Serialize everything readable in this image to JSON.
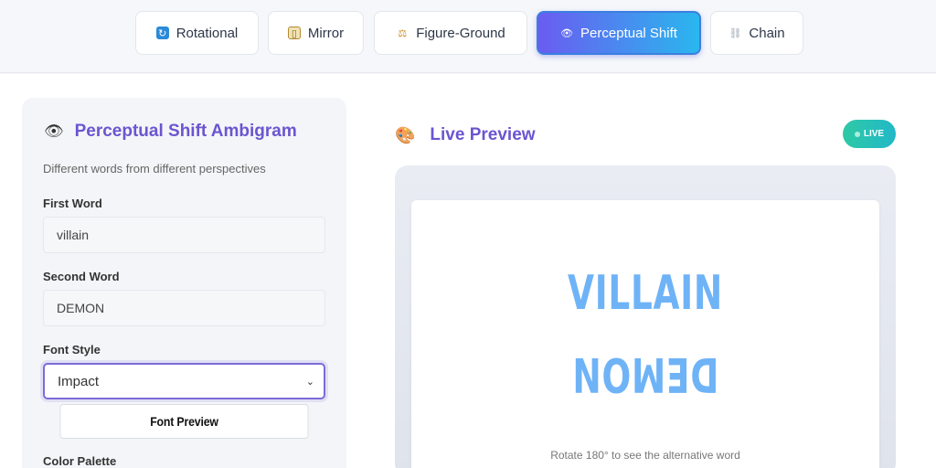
{
  "tabs": [
    {
      "label": "Rotational",
      "icon": "rotate-icon",
      "active": false
    },
    {
      "label": "Mirror",
      "icon": "mirror-icon",
      "active": false
    },
    {
      "label": "Figure-Ground",
      "icon": "scale-icon",
      "active": false
    },
    {
      "label": "Perceptual Shift",
      "icon": "eye-icon",
      "active": true
    },
    {
      "label": "Chain",
      "icon": "chain-icon",
      "active": false
    }
  ],
  "panel": {
    "title": "Perceptual Shift Ambigram",
    "subtitle": "Different words from different perspectives",
    "first_word_label": "First Word",
    "first_word_value": "villain",
    "second_word_label": "Second Word",
    "second_word_value": "DEMON",
    "font_style_label": "Font Style",
    "font_style_value": "Impact",
    "font_preview_label": "Font Preview",
    "color_palette_label": "Color Palette"
  },
  "preview": {
    "title": "Live Preview",
    "live_badge": "LIVE",
    "word_top": "VILLAIN",
    "word_bottom": "DEMON",
    "hint": "Rotate 180° to see the alternative word"
  },
  "colors": {
    "accent": "#6b55d0",
    "word": "#6fb3f7",
    "live_badge": "#2ec9a5"
  }
}
